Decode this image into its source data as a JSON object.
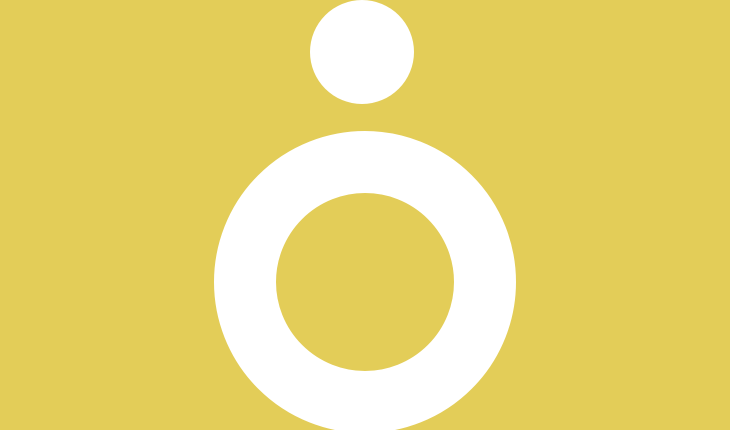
{
  "colors": {
    "background": "#E3CD58",
    "foreground": "#FFFFFF"
  },
  "logo": {
    "icon": "person-figure-icon",
    "parts": [
      "head-dot-icon",
      "body-ring-icon"
    ]
  }
}
